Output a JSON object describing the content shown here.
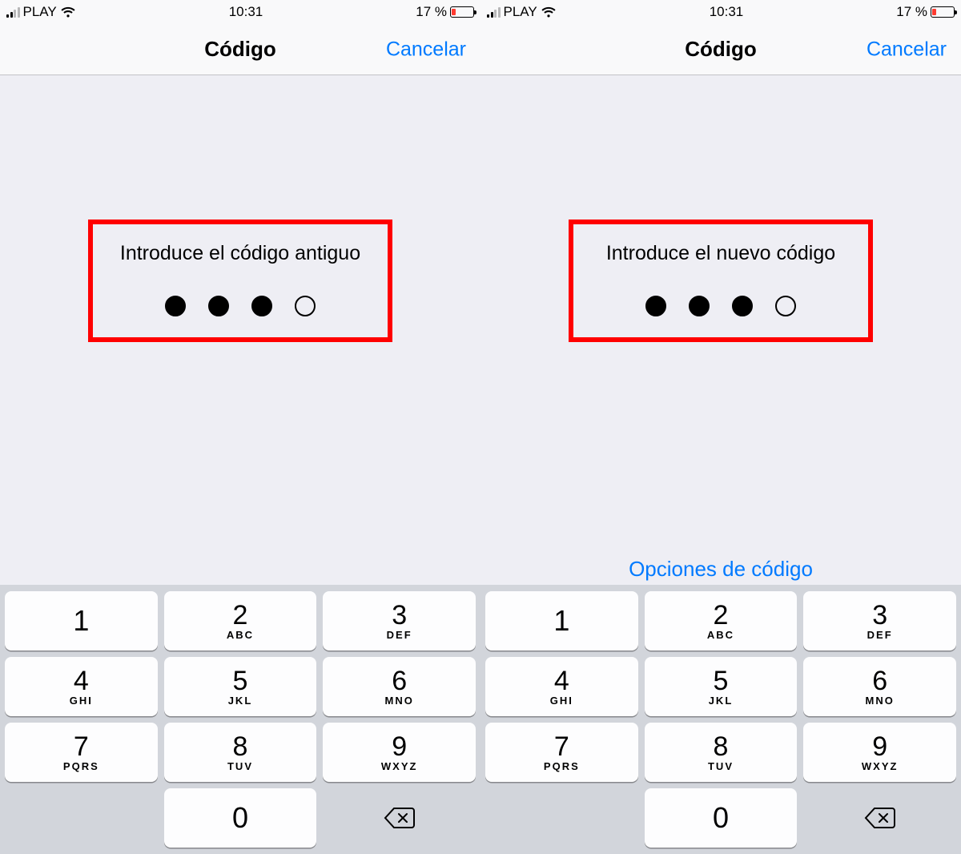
{
  "status": {
    "carrier": "PLAY",
    "time": "10:31",
    "battery_pct": "17 %"
  },
  "nav": {
    "title": "Código",
    "cancel": "Cancelar"
  },
  "screens": [
    {
      "prompt": "Introduce el código antiguo",
      "dots_filled": 3,
      "dots_total": 4,
      "show_options": false
    },
    {
      "prompt": "Introduce el nuevo código",
      "dots_filled": 3,
      "dots_total": 4,
      "show_options": true
    }
  ],
  "options_label": "Opciones de código",
  "keypad": [
    {
      "digit": "1",
      "letters": ""
    },
    {
      "digit": "2",
      "letters": "ABC"
    },
    {
      "digit": "3",
      "letters": "DEF"
    },
    {
      "digit": "4",
      "letters": "GHI"
    },
    {
      "digit": "5",
      "letters": "JKL"
    },
    {
      "digit": "6",
      "letters": "MNO"
    },
    {
      "digit": "7",
      "letters": "PQRS"
    },
    {
      "digit": "8",
      "letters": "TUV"
    },
    {
      "digit": "9",
      "letters": "WXYZ"
    }
  ],
  "key_zero": "0",
  "icons": {
    "backspace": "backspace-icon",
    "wifi": "wifi-icon",
    "signal": "signal-icon",
    "battery": "battery-icon"
  },
  "colors": {
    "accent": "#007aff",
    "highlight_box": "#ff0000",
    "battery_low": "#ff3b30"
  }
}
